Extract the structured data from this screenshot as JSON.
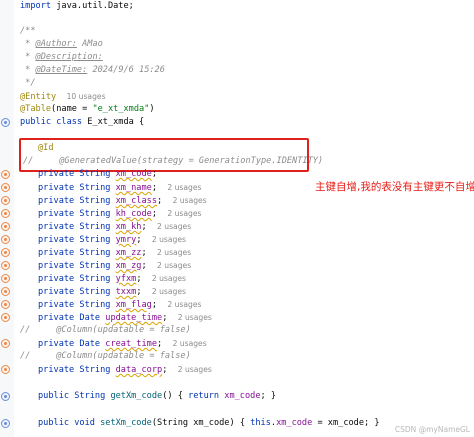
{
  "code": {
    "import_kw": "import",
    "import_rest": " java.util.Date;",
    "doc_open": "/**",
    "doc_author_prefix": " * ",
    "doc_author_tag": "@Author:",
    "doc_author_val": " AMao",
    "doc_desc_prefix": " * ",
    "doc_desc_tag": "@Description:",
    "doc_date_prefix": " * ",
    "doc_date_tag": "@DateTime:",
    "doc_date_val": " 2024/9/6 15:26",
    "doc_close": " */",
    "entity_ann": "@Entity",
    "entity_hint": "10 usages",
    "table_ann": "@Table",
    "table_args_a": "(name = ",
    "table_args_str": "\"e_xt_xmda\"",
    "table_args_b": ")",
    "class_kw": "public class ",
    "class_name": "E_xt_xmda {",
    "id_ann": "@Id",
    "genval_comment": "//     @GeneratedValue(strategy = GenerationType.IDENTITY)",
    "fields": [
      {
        "mods": "private String ",
        "name": "xm_code",
        "tail": ";",
        "hint": ""
      },
      {
        "mods": "private String ",
        "name": "xm_name",
        "tail": ";",
        "hint": "2 usages"
      },
      {
        "mods": "private String ",
        "name": "xm_class",
        "tail": ";",
        "hint": "2 usages"
      },
      {
        "mods": "private String ",
        "name": "kh_code",
        "tail": ";",
        "hint": "2 usages"
      },
      {
        "mods": "private String ",
        "name": "xm_kh",
        "tail": ";",
        "hint": "2 usages"
      },
      {
        "mods": "private String ",
        "name": "ymry",
        "tail": ";",
        "hint": "2 usages"
      },
      {
        "mods": "private String ",
        "name": "xm_zz",
        "tail": ";",
        "hint": "2 usages"
      },
      {
        "mods": "private String ",
        "name": "xm_zg",
        "tail": ";",
        "hint": "2 usages"
      },
      {
        "mods": "private String ",
        "name": "yfxm",
        "tail": ";",
        "hint": "2 usages"
      },
      {
        "mods": "private String ",
        "name": "txxm",
        "tail": ";",
        "hint": "2 usages"
      },
      {
        "mods": "private String ",
        "name": "xm_flag",
        "tail": ";",
        "hint": "2 usages"
      },
      {
        "mods": "private Date ",
        "name": "update_time",
        "tail": ";",
        "hint": "2 usages"
      }
    ],
    "col_comment_1": "//     @Column(updatable = false)",
    "creat_field": {
      "mods": "private Date ",
      "name": "creat_time",
      "tail": ";",
      "hint": "2 usages"
    },
    "col_comment_2": "//     @Column(updatable = false)",
    "corp_field": {
      "mods": "private String ",
      "name": "data_corp",
      "tail": ";",
      "hint": "2 usages"
    },
    "getter_kw": "public String ",
    "getter_name": "getXm_code",
    "getter_body_a": "() { ",
    "getter_return": "return ",
    "getter_field": "xm_code",
    "getter_body_b": "; }",
    "setter_kw": "public void ",
    "setter_name": "setXm_code",
    "setter_args_a": "(String ",
    "setter_param": "xm_code",
    "setter_args_b": ") { ",
    "setter_this": "this",
    "setter_dot": ".",
    "setter_field": "xm_code",
    "setter_assign": " = xm_code; }"
  },
  "annotation_note": "主键自增,我的表没有主键更不自增",
  "watermark": "CSDN @myNameGL",
  "colors": {
    "keyword": "#0033b3",
    "annotation": "#9e880d",
    "string": "#067d17",
    "field": "#871094",
    "comment": "#8c8c8c",
    "highlight_box": "#e0201b",
    "note_text": "#e8201b"
  }
}
